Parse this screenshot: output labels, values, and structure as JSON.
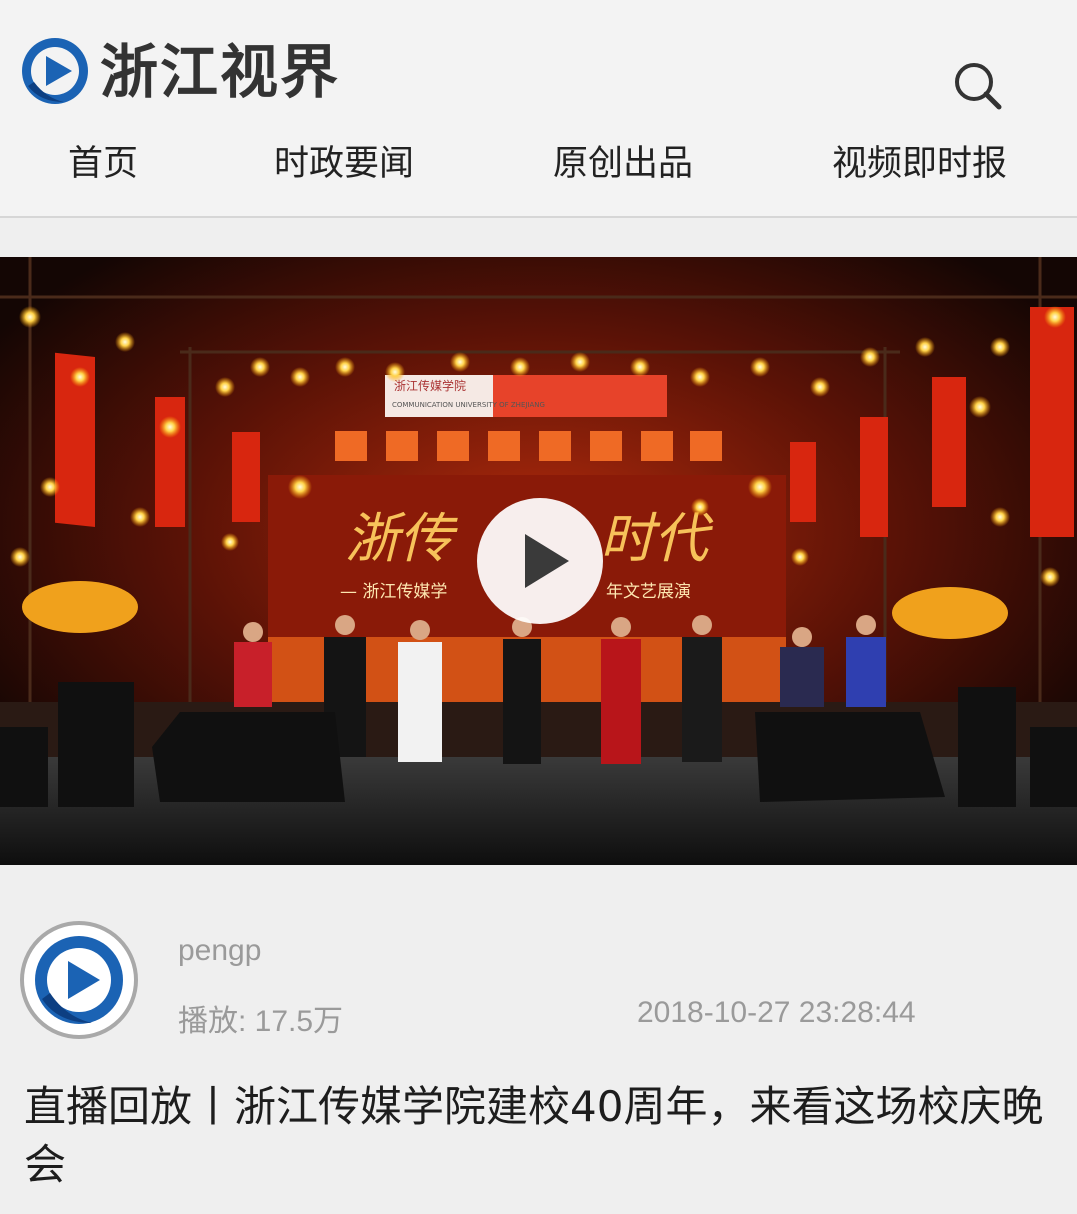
{
  "header": {
    "brand": "浙江视界",
    "logo_icon": "play-circle-logo-icon",
    "search_icon": "search-icon",
    "colors": {
      "logo_blue": "#1b63b4",
      "logo_dark": "#0d3f82"
    }
  },
  "nav": {
    "items": [
      {
        "label": "首页"
      },
      {
        "label": "时政要闻"
      },
      {
        "label": "原创出品"
      },
      {
        "label": "视频即时报"
      }
    ]
  },
  "video": {
    "play_icon": "play-icon",
    "thumbnail": {
      "banner_sign": "浙江传媒学院",
      "banner_sub": "COMMUNICATION UNIVERSITY OF ZHEJIANG",
      "screen_title_left": "浙传",
      "screen_title_right": "时代",
      "screen_subtitle_left": "— 浙江传媒学",
      "screen_subtitle_right": "年文艺展演"
    }
  },
  "meta": {
    "author": "pengp",
    "plays": "播放: 17.5万",
    "date": "2018-10-27 23:28:44"
  },
  "article": {
    "title": "直播回放丨浙江传媒学院建校40周年，来看这场校庆晚会"
  }
}
